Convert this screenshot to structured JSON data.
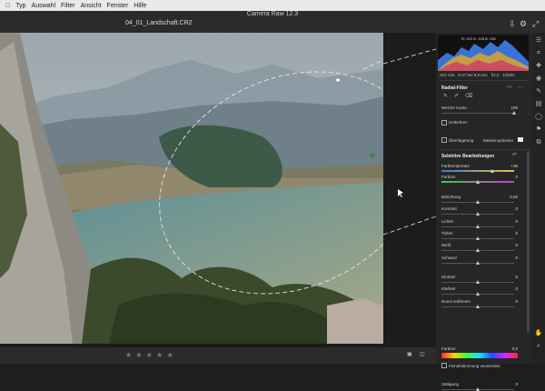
{
  "menu": [
    "Typ",
    "Auswahl",
    "Filter",
    "Ansicht",
    "Fenster",
    "Hilfe"
  ],
  "app_title": "Camera Raw 12.3",
  "filename": "04_01_Landschaft.CR2",
  "histogram": {
    "readout": "R: 123   G: 128   B: 136"
  },
  "exif": {
    "iso": "ISO 125",
    "lens": "8-37 bei 8,8 mm",
    "aperture": "f/4,0",
    "shutter": "1/250s"
  },
  "radial": {
    "title": "Radial-Filter",
    "soft_edge_label": "Weiche Kante",
    "soft_edge_value": "100",
    "soft_edge_frac": 1.0,
    "invert_label": "Umkehren",
    "overlay_label": "Überlagerung",
    "mask_label": "Maskenoptionen"
  },
  "selective": {
    "title": "Selektive Bearbeitungen",
    "temp_label": "Farbtemperatur",
    "temp_value": "+36",
    "tint_label": "Farbton",
    "tint_value": "0",
    "adjustments": [
      {
        "label": "Belichtung",
        "value": "0,00"
      },
      {
        "label": "Kontrast",
        "value": "0"
      },
      {
        "label": "Lichter",
        "value": "0"
      },
      {
        "label": "Tiefen",
        "value": "0"
      },
      {
        "label": "Weiß",
        "value": "0"
      },
      {
        "label": "Schwarz",
        "value": "0"
      }
    ],
    "adjustments2": [
      {
        "label": "Struktur",
        "value": "0"
      },
      {
        "label": "Klarheit",
        "value": "0"
      },
      {
        "label": "Dunst entfernen",
        "value": "0"
      }
    ],
    "color_label": "Farbton",
    "color_value": "0,0",
    "fine_label": "Feinabstimmung verwenden",
    "sat_label": "Sättigung",
    "sat_value": "0"
  },
  "rating_stars": "★ ★ ★ ★ ★"
}
